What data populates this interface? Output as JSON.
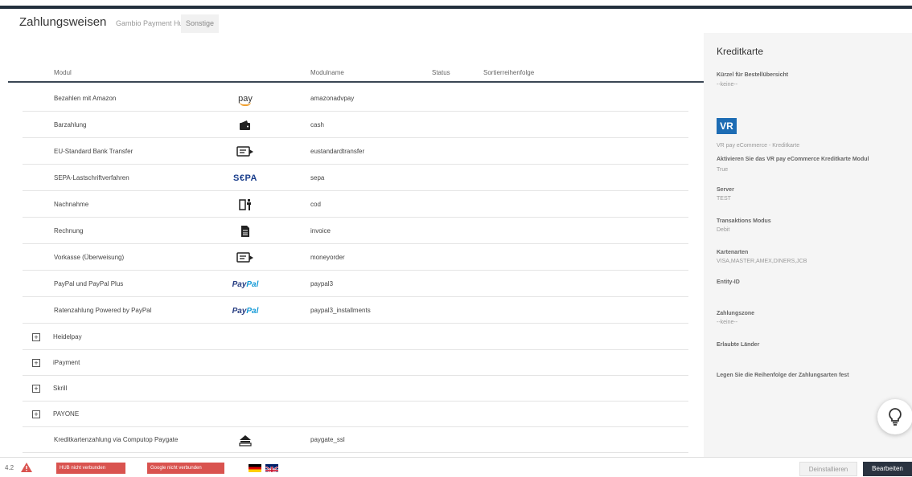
{
  "header": {
    "title": "Zahlungsweisen",
    "tabs": [
      "Gambio Payment Hub",
      "Sonstige"
    ]
  },
  "table": {
    "columns": [
      "Modul",
      "Modulname",
      "Status",
      "Sortierreihenfolge"
    ],
    "rows": [
      {
        "label": "Bezahlen mit Amazon",
        "code": "amazonadvpay",
        "icon": "amazon-pay-icon",
        "logo_text": "pay"
      },
      {
        "label": "Barzahlung",
        "code": "cash",
        "icon": "wallet-icon"
      },
      {
        "label": "EU-Standard Bank Transfer",
        "code": "eustandardtransfer",
        "icon": "money-transfer-icon"
      },
      {
        "label": "SEPA-Lastschriftverfahren",
        "code": "sepa",
        "icon": "sepa-icon",
        "logo_text": "S€PA"
      },
      {
        "label": "Nachnahme",
        "code": "cod",
        "icon": "cash-on-delivery-icon"
      },
      {
        "label": "Rechnung",
        "code": "invoice",
        "icon": "invoice-icon"
      },
      {
        "label": "Vorkasse (Überweisung)",
        "code": "moneyorder",
        "icon": "money-transfer-icon"
      },
      {
        "label": "PayPal und PayPal Plus",
        "code": "paypal3",
        "icon": "paypal-icon",
        "logo_a": "Pay",
        "logo_b": "Pal"
      },
      {
        "label": "Ratenzahlung Powered by PayPal",
        "code": "paypal3_installments",
        "icon": "paypal-icon",
        "logo_a": "Pay",
        "logo_b": "Pal"
      }
    ],
    "groups": [
      "Heidelpay",
      "iPayment",
      "Skrill",
      "PAYONE"
    ],
    "last_row": {
      "label": "Kreditkartenzahlung via Computop Paygate",
      "code": "paygate_ssl",
      "icon": "credit-card-payment-icon"
    }
  },
  "sidebar": {
    "title": "Kreditkarte",
    "shortcut_label": "Kürzel für Bestellübersicht",
    "shortcut_value": "--keine--",
    "logo_text": "VR",
    "description": "VR pay eCommerce - Kreditkarte",
    "activate_label": "Aktivieren Sie das VR pay eCommerce Kreditkarte Modul",
    "activate_value": "True",
    "server_label": "Server",
    "server_value": "TEST",
    "transaction_label": "Transaktions Modus",
    "transaction_value": "Debit",
    "cards_label": "Kartenarten",
    "cards_value": "VISA,MASTER,AMEX,DINERS,JCB",
    "entity_label": "Entity-ID",
    "zone_label": "Zahlungszone",
    "zone_value": "--keine--",
    "countries_label": "Erlaubte Länder",
    "sort_label": "Legen Sie die Reihenfolge der Zahlungsarten fest"
  },
  "footer": {
    "version": "4.2",
    "hub_badge": "HUB nicht verbunden",
    "google_badge": "Google nicht verbunden",
    "uninstall": "Deinstallieren",
    "edit": "Bearbeiten"
  },
  "colors": {
    "topbar": "#23303d",
    "badge": "#d9534f",
    "primary_button": "#2a3340",
    "sidebar_bg": "#f5f5f5"
  }
}
